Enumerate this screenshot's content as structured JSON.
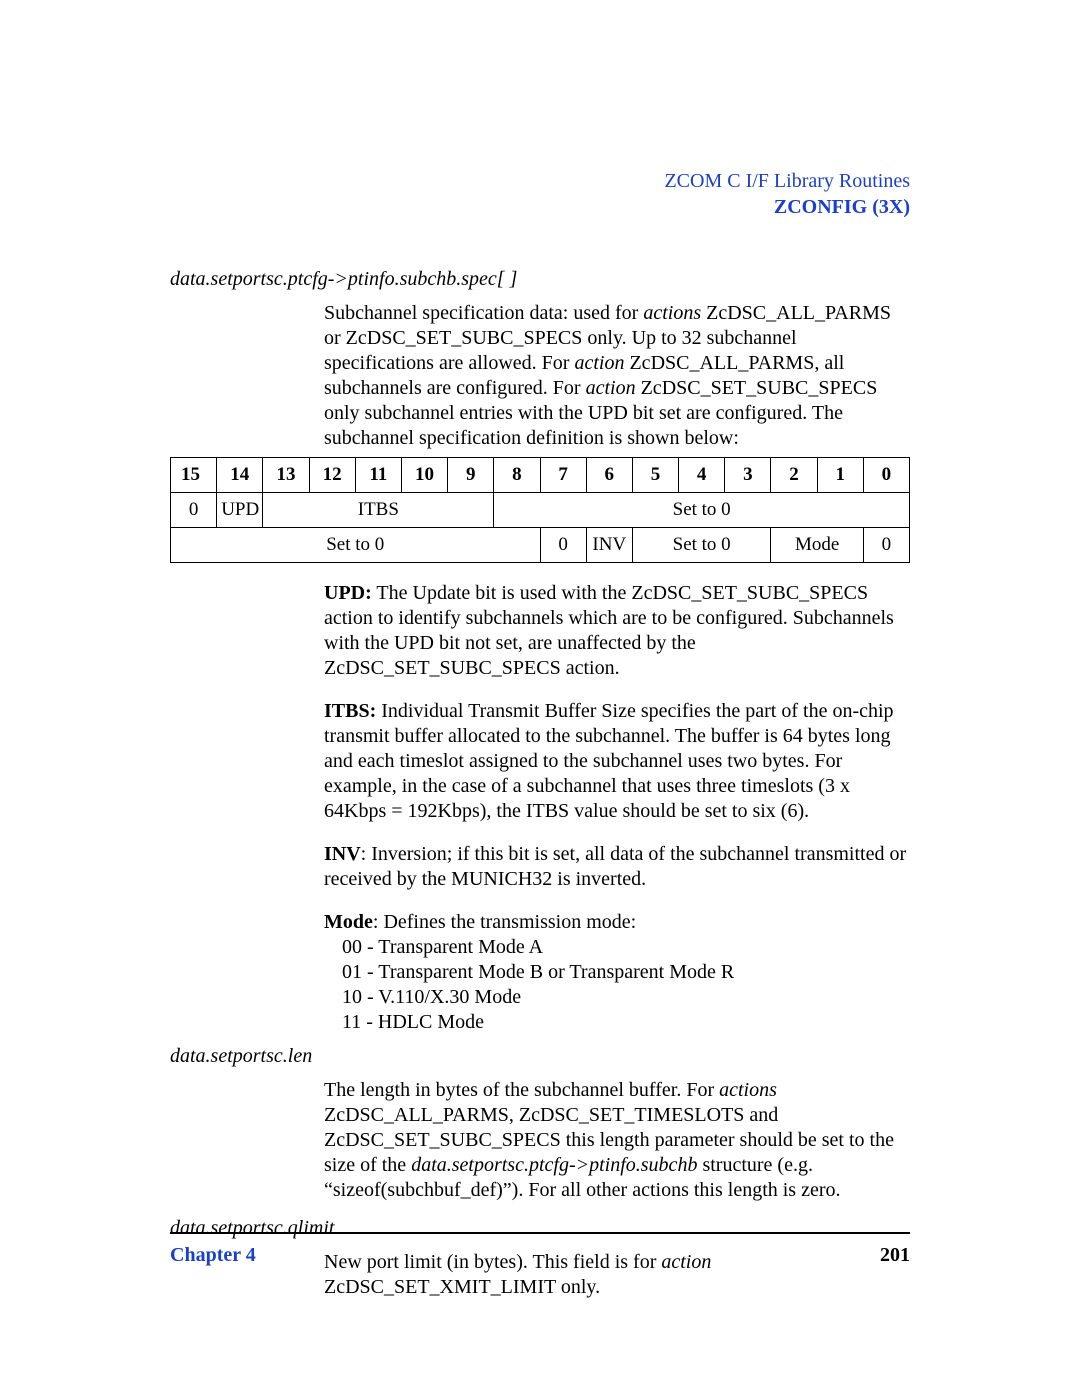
{
  "header": {
    "line1": "ZCOM C I/F Library Routines",
    "line2": "ZCONFIG (3X)"
  },
  "section1": {
    "heading": "data.setportsc.ptcfg->ptinfo.subchb.spec[ ]",
    "para": "Subchannel specification data: used for actions ZcDSC_ALL_PARMS or ZcDSC_SET_SUBC_SPECS only. Up to 32 subchannel specifications are allowed. For action ZcDSC_ALL_PARMS, all subchannels are configured. For action ZcDSC_SET_SUBC_SPECS only subchannel entries with the UPD bit set are configured. The subchannel specification definition is shown below:"
  },
  "bits_table": {
    "headers": [
      "15",
      "14",
      "13",
      "12",
      "11",
      "10",
      "9",
      "8",
      "7",
      "6",
      "5",
      "4",
      "3",
      "2",
      "1",
      "0"
    ],
    "row1": {
      "c0": "0",
      "c1": "UPD",
      "c2_6": "ITBS",
      "c7_15": "Set to 0"
    },
    "row2": {
      "c0_7": "Set to 0",
      "c8": "0",
      "c9": "INV",
      "c10_12": "Set to 0",
      "c13_14": "Mode",
      "c15": "0"
    }
  },
  "defs": {
    "upd_label": "UPD:",
    "upd_text": " The Update bit is used with the ZcDSC_SET_SUBC_SPECS action to identify subchannels which are to be configured. Subchannels with the UPD bit not set, are unaffected by the ZcDSC_SET_SUBC_SPECS action.",
    "itbs_label": "ITBS:",
    "itbs_text": " Individual Transmit Buffer Size specifies the part of the on-chip transmit buffer allocated to the subchannel. The buffer is 64 bytes long and each timeslot assigned to the subchannel uses two bytes. For example, in the case of a subchannel that uses three timeslots (3 x 64Kbps = 192Kbps), the ITBS value should be set to six (6).",
    "inv_label": "INV",
    "inv_text": ": Inversion; if this bit is set, all data of the subchannel transmitted or received by the MUNICH32 is inverted.",
    "mode_label": "Mode",
    "mode_text": ": Defines the transmission mode:",
    "mode_00": "00 - Transparent Mode A",
    "mode_01": "01 - Transparent Mode B or Transparent Mode R",
    "mode_10": "10 - V.110/X.30 Mode",
    "mode_11": "11 - HDLC Mode"
  },
  "section2": {
    "heading": "data.setportsc.len",
    "para": "The length in bytes of the subchannel buffer. For actions ZcDSC_ALL_PARMS, ZcDSC_SET_TIMESLOTS and ZcDSC_SET_SUBC_SPECS this length parameter should be set to the size of the data.setportsc.ptcfg->ptinfo.subchb structure (e.g. “sizeof(subchbuf_def)”). For all other actions this length is zero."
  },
  "section3": {
    "heading": "data.setportsc.qlimit",
    "para": "New port limit (in bytes). This field is for action ZcDSC_SET_XMIT_LIMIT only."
  },
  "footer": {
    "left": "Chapter 4",
    "right": "201"
  }
}
